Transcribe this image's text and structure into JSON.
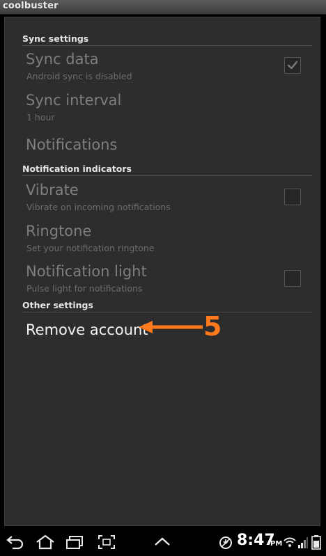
{
  "app": {
    "title": "coolbuster"
  },
  "sections": {
    "sync": "Sync settings",
    "notifications": "Notification indicators",
    "other": "Other settings"
  },
  "prefs": {
    "sync_data": {
      "title": "Sync data",
      "summary": "Android sync is disabled",
      "checked": true
    },
    "sync_interval": {
      "title": "Sync interval",
      "summary": "1 hour"
    },
    "notifications": {
      "title": "Notifications"
    },
    "vibrate": {
      "title": "Vibrate",
      "summary": "Vibrate on incoming notifications",
      "checked": false
    },
    "ringtone": {
      "title": "Ringtone",
      "summary": "Set your notification ringtone"
    },
    "notification_light": {
      "title": "Notification light",
      "summary": "Pulse light for notifications",
      "checked": false
    },
    "remove_account": {
      "title": "Remove account"
    }
  },
  "annotation": {
    "step": "5",
    "color": "#ff7a1c"
  },
  "status_bar": {
    "time": "8:47",
    "ampm": "PM"
  },
  "icons": {
    "back": "back-icon",
    "home": "home-icon",
    "recent": "recent-apps-icon",
    "screenshot": "screenshot-icon",
    "up": "chevron-up-icon",
    "sync_status": "sync-status-icon",
    "wifi": "wifi-icon",
    "signal": "signal-icon",
    "battery": "battery-icon"
  }
}
